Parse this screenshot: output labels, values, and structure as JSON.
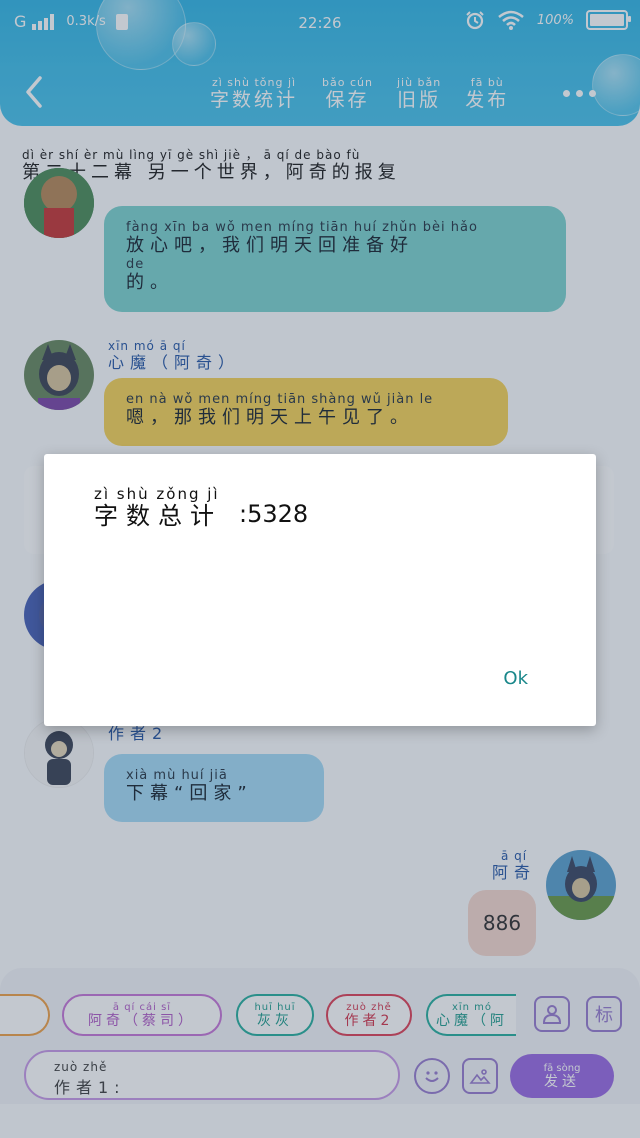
{
  "status_bar": {
    "network": "G",
    "speed": "0.3k/s",
    "time": "22:26",
    "battery": "100%"
  },
  "header": {
    "toolbar": [
      {
        "pinyin": "zì shù tǒng jì",
        "label": "字数统计"
      },
      {
        "pinyin": "bǎo cún",
        "label": "保存"
      },
      {
        "pinyin": "jiù bǎn",
        "label": "旧版"
      },
      {
        "pinyin": "fā bù",
        "label": "发布"
      }
    ]
  },
  "chapter": {
    "pinyin": "dì èr shí èr mù   lìng yī gè shì jiè ，  ā qí de bào fù",
    "title": "第二十二幕 另一个世界，阿奇的报复"
  },
  "messages": [
    {
      "pinyin": "fàng xīn ba      wǒ men míng tiān huí zhǔn bèi hǎo",
      "text": "放心吧，我们明天回准备好",
      "pinyin2": "de",
      "text2": "的。"
    },
    {
      "sender_pinyin": "xīn mó     ā qí",
      "sender": "心魔（阿奇）",
      "pinyin": "en       nà  wǒ men míng tiān shàng wǔ jiàn le",
      "text": "嗯，那我们明天上午见了。"
    },
    {
      "sender": "作者2",
      "pinyin": "xià mù       huí jiā",
      "text": "下幕“回家”"
    },
    {
      "sender_pinyin": "ā qí",
      "sender": "阿奇",
      "text": "886"
    }
  ],
  "bottom_bar": {
    "chips": [
      {
        "pinyin": "ā qí    cái sī",
        "label": "阿奇（蔡司）"
      },
      {
        "pinyin": "huī huī",
        "label": "灰灰"
      },
      {
        "pinyin": "zuò zhě",
        "label": "作者2"
      },
      {
        "pinyin": "xīn mó",
        "label": "心魔（阿"
      }
    ],
    "mark_button": "标",
    "input": {
      "pinyin": "zuò zhě",
      "label": "作者1:"
    },
    "send": {
      "pinyin": "fā sòng",
      "label": "发送"
    }
  },
  "dialog": {
    "label_pinyin": "zì shù zǒng jì",
    "label": "字数总计",
    "value": ":5328",
    "ok": "Ok"
  },
  "colors": {
    "header": "#44bfe9",
    "bubble_teal": "#7fd3cf",
    "bubble_yellow": "#f6d35a",
    "bubble_blue": "#a7dcf5",
    "bubble_pink": "#f6d8cf",
    "send": "#9b6ce3",
    "ok_text": "#19878a"
  }
}
